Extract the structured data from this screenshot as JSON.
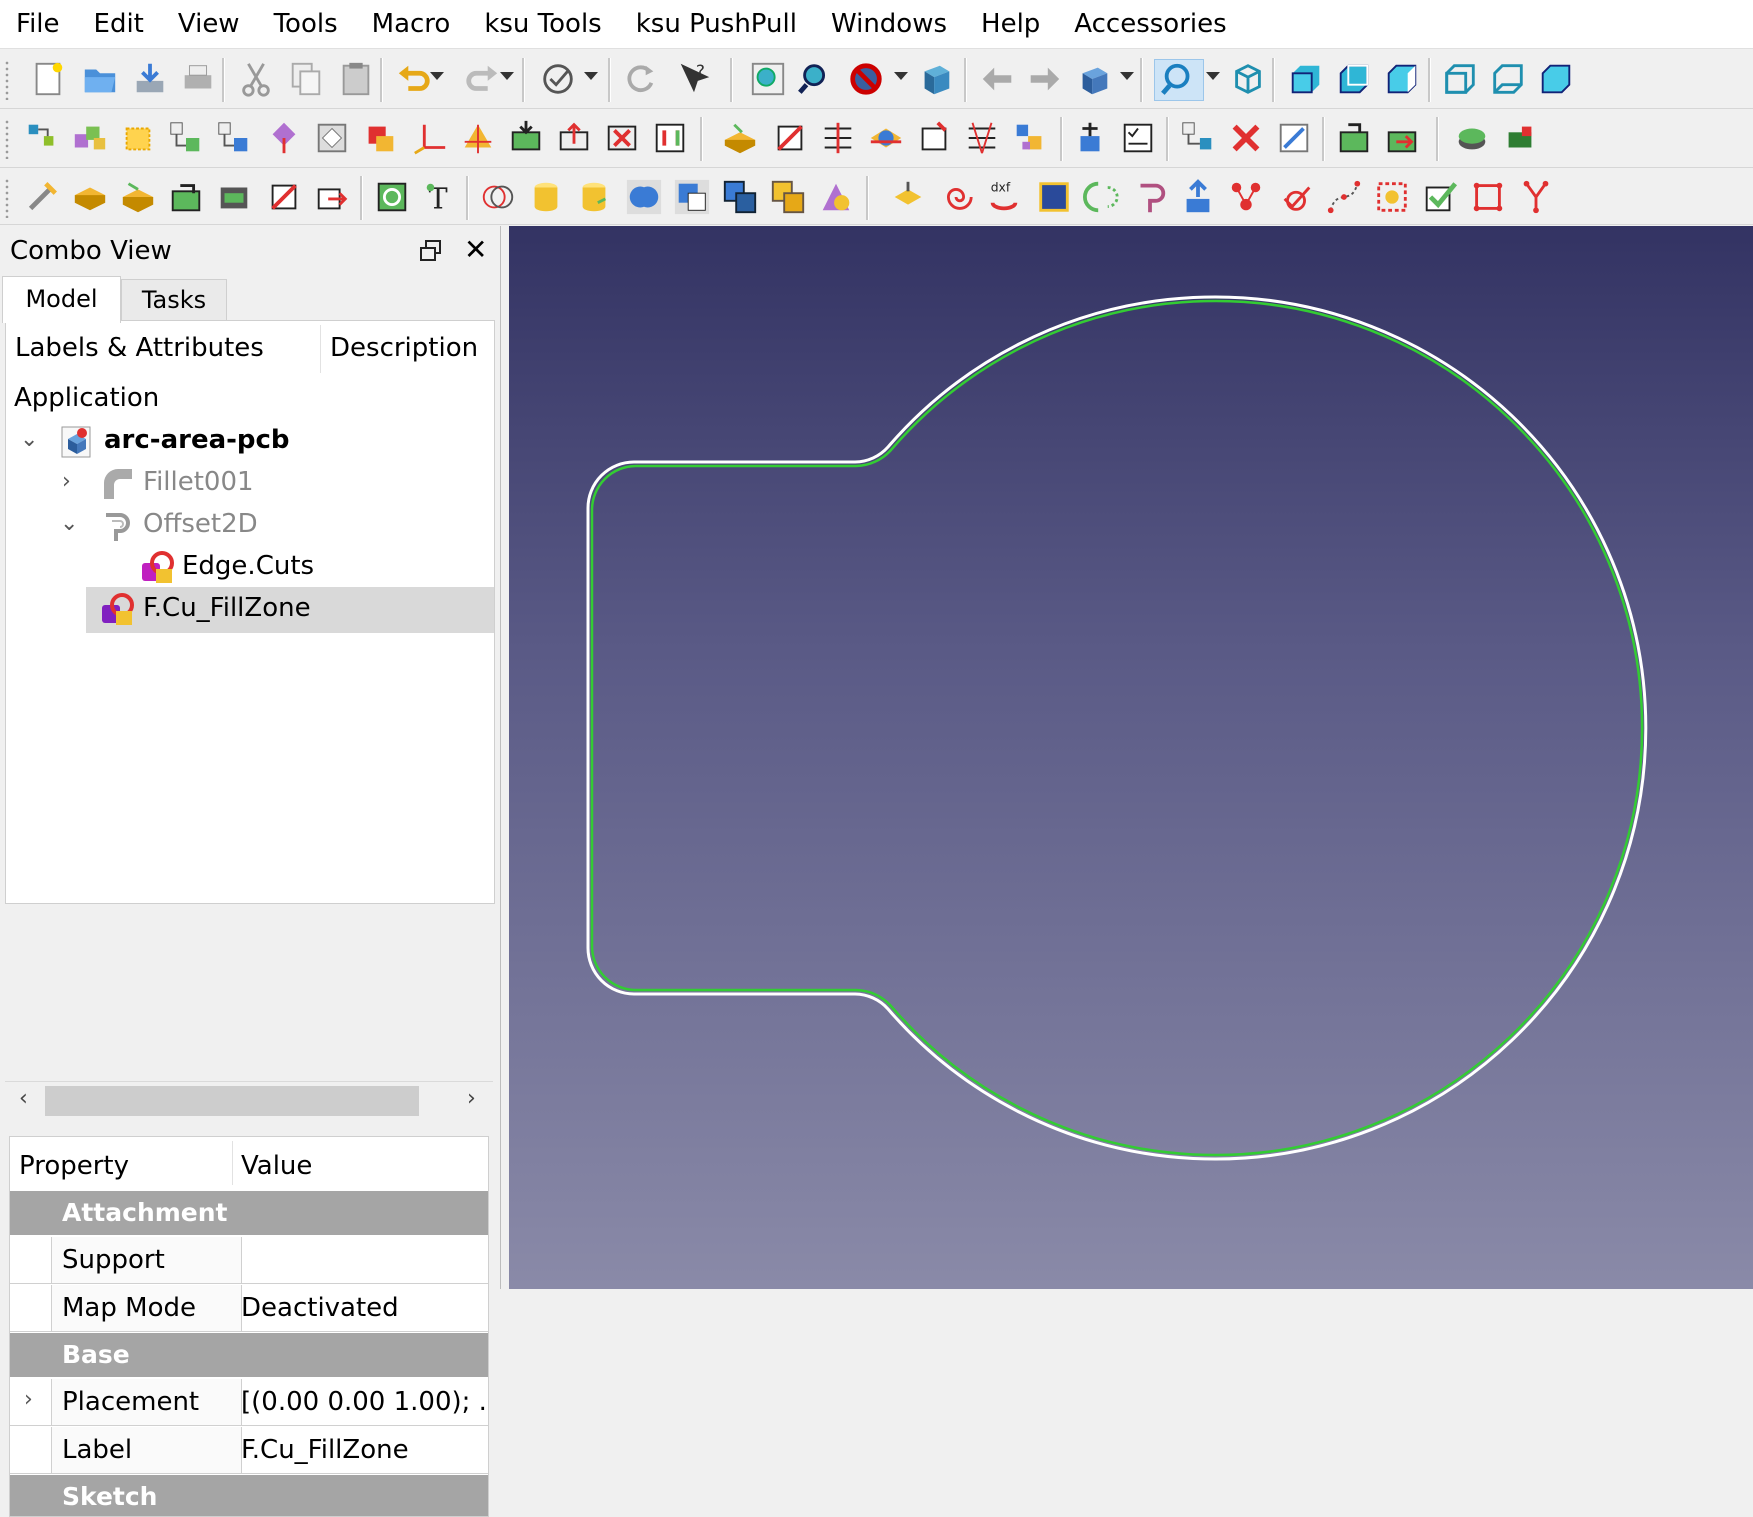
{
  "menu": [
    "File",
    "Edit",
    "View",
    "Tools",
    "Macro",
    "ksu Tools",
    "ksu PushPull",
    "Windows",
    "Help",
    "Accessories"
  ],
  "combo_view": {
    "title": "Combo View",
    "tabs": [
      "Model",
      "Tasks"
    ],
    "tree": {
      "col_labels": "Labels & Attributes",
      "col_description": "Description",
      "root": "Application",
      "items": [
        {
          "label": "arc-area-pcb",
          "icon": "document-part-icon"
        },
        {
          "label": "Fillet001",
          "icon": "fillet-icon"
        },
        {
          "label": "Offset2D",
          "icon": "offset2d-icon"
        },
        {
          "label": "Edge.Cuts",
          "icon": "sketch-icon"
        },
        {
          "label": "F.Cu_FillZone",
          "icon": "sketch-icon"
        }
      ]
    },
    "properties": {
      "col_property": "Property",
      "col_value": "Value",
      "groups": {
        "attachment": "Attachment",
        "base": "Base",
        "sketch": "Sketch"
      },
      "rows": {
        "support": {
          "name": "Support",
          "value": ""
        },
        "map_mode": {
          "name": "Map Mode",
          "value": "Deactivated"
        },
        "placement": {
          "name": "Placement",
          "value": "[(0.00 0.00 1.00); ..."
        },
        "label": {
          "name": "Label",
          "value": "F.Cu_FillZone"
        }
      }
    }
  },
  "colors": {
    "view_top": "#333363",
    "view_bottom": "#8a8aa8",
    "outline_white": "#ffffff",
    "outline_green": "#33cc33",
    "selection_grey": "#d9d9d9",
    "group_header": "#a5a5a5"
  }
}
